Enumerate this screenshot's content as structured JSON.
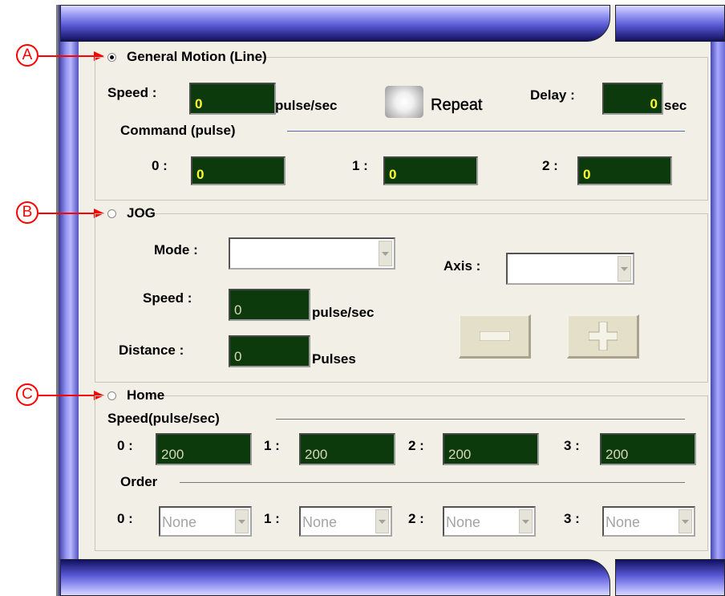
{
  "callouts": {
    "a": "A",
    "b": "B",
    "c": "C"
  },
  "general_motion": {
    "title": "General Motion (Line)",
    "speed_label": "Speed :",
    "speed_value": "0",
    "speed_unit": "pulse/sec",
    "repeat_label": "Repeat",
    "delay_label": "Delay :",
    "delay_value": "0",
    "delay_unit": "sec",
    "command_label": "Command (pulse)",
    "commands": [
      {
        "label": "0 :",
        "value": "0"
      },
      {
        "label": "1 :",
        "value": "0"
      },
      {
        "label": "2 :",
        "value": "0"
      }
    ]
  },
  "jog": {
    "title": "JOG",
    "mode_label": "Mode :",
    "mode_value": "",
    "axis_label": "Axis :",
    "axis_value": "",
    "speed_label": "Speed :",
    "speed_value": "0",
    "speed_unit": "pulse/sec",
    "distance_label": "Distance :",
    "distance_value": "0",
    "distance_unit": "Pulses"
  },
  "home": {
    "title": "Home",
    "speed_label": "Speed(pulse/sec)",
    "speeds": [
      {
        "label": "0 :",
        "value": "200"
      },
      {
        "label": "1 :",
        "value": "200"
      },
      {
        "label": "2 :",
        "value": "200"
      },
      {
        "label": "3 :",
        "value": "200"
      }
    ],
    "order_label": "Order",
    "orders": [
      {
        "label": "0 :",
        "value": "None"
      },
      {
        "label": "1 :",
        "value": "None"
      },
      {
        "label": "2 :",
        "value": "None"
      },
      {
        "label": "3 :",
        "value": "None"
      }
    ]
  },
  "selected_mode": "general_motion"
}
